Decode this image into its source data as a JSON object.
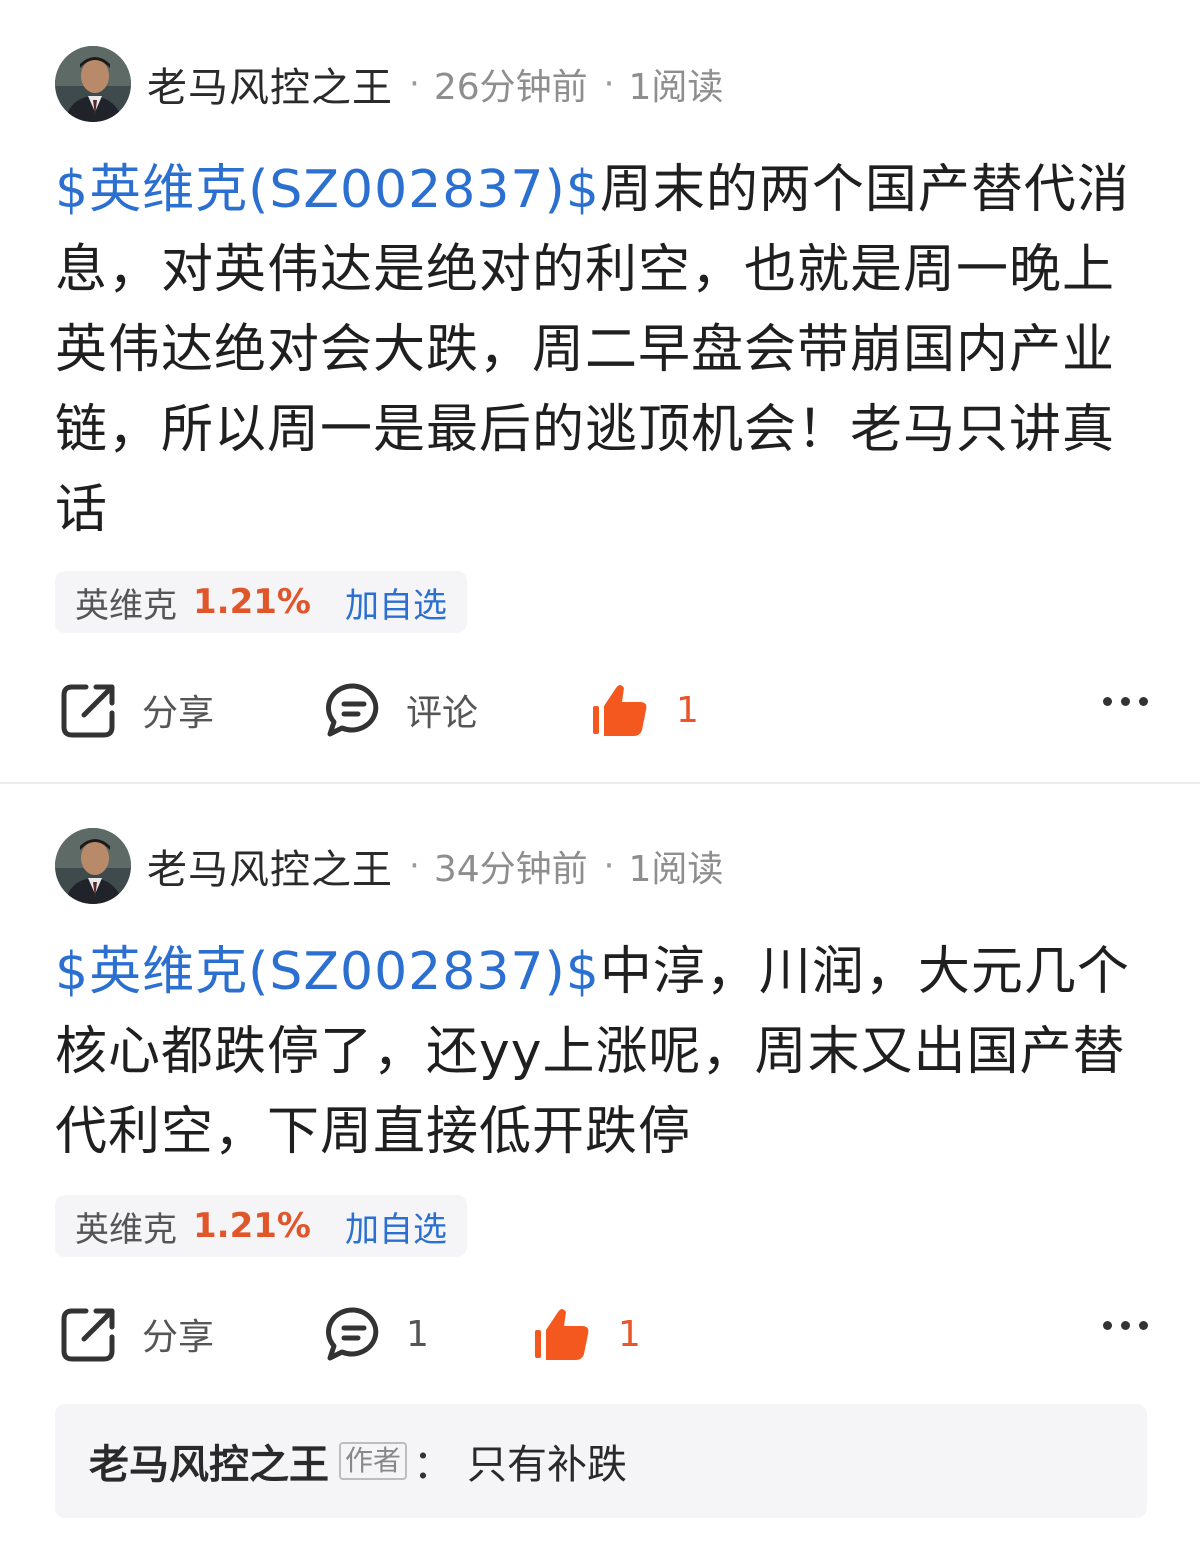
{
  "posts": [
    {
      "author": "老马风控之王",
      "time": "26分钟前",
      "reads": "1阅读",
      "stock_link": "$英维克(SZ002837)$",
      "text": "周末的两个国产替代消息，对英伟达是绝对的利空，也就是周一晚上英伟达绝对会大跌，周二早盘会带崩国内产业链，所以周一是最后的逃顶机会！老马只讲真话",
      "stock_chip": {
        "name": "英维克",
        "change": "1.21%",
        "add_label": "加自选"
      },
      "actions": {
        "share": "分享",
        "comment": "评论",
        "likes": "1"
      }
    },
    {
      "author": "老马风控之王",
      "time": "34分钟前",
      "reads": "1阅读",
      "stock_link": "$英维克(SZ002837)$",
      "text": "中淳，川润，大元几个核心都跌停了，还yy上涨呢，周末又出国产替代利空，下周直接低开跌停",
      "stock_chip": {
        "name": "英维克",
        "change": "1.21%",
        "add_label": "加自选"
      },
      "actions": {
        "share": "分享",
        "comment": "1",
        "likes": "1"
      },
      "reply": {
        "author": "老马风控之王",
        "tag": "作者",
        "colon": "：",
        "text": "只有补跌"
      }
    }
  ],
  "separator": "·",
  "icons": {
    "share": "share-icon",
    "comment": "comment-bubble-icon",
    "like": "thumbs-up-icon",
    "more": "more-dots-icon"
  },
  "colors": {
    "link": "#2b6fd1",
    "like": "#f4581f",
    "rise": "#e0552a"
  }
}
